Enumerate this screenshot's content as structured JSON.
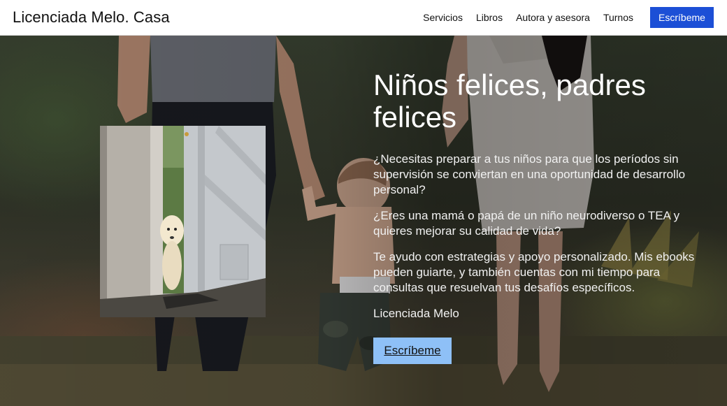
{
  "header": {
    "brand": "Licenciada Melo. Casa",
    "nav": [
      "Servicios",
      "Libros",
      "Autora y asesora",
      "Turnos"
    ],
    "cta_label": "Escríbeme"
  },
  "hero": {
    "title": "Niños felices, padres felices",
    "paragraphs": [
      "¿Necesitas preparar a tus niños para que los períodos sin supervisión se conviertan en una oportunidad de desarrollo personal?",
      "¿Eres una mamá o papá de un niño neurodiverso o TEA y quieres mejorar su calidad de vida?",
      "Te ayudo con estrategias y apoyo personalizado. Mis ebooks pueden guiarte, y también cuentas con mi tiempo para consultas que resuelvan tus desafíos específicos."
    ],
    "signature": "Licenciada Melo",
    "cta_label": "Escríbeme"
  },
  "colors": {
    "header_cta": "#1c4fd6",
    "hero_cta": "#8ec0f7"
  }
}
